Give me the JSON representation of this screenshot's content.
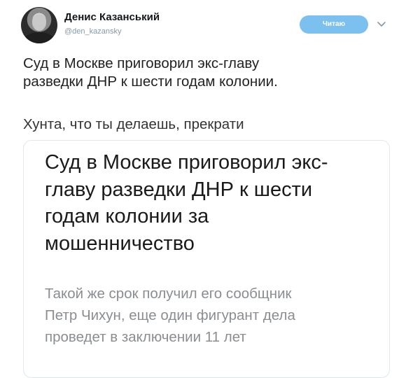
{
  "author": {
    "name": "Денис Казанський",
    "handle": "@den_kazansky"
  },
  "header": {
    "follow_label": "Читаю"
  },
  "tweet": {
    "lines": [
      "Суд в Москве приговорил экс-главу",
      "разведки ДНР к шести годам колонии."
    ],
    "comment": "Хунта, что ты делаешь, прекрати"
  },
  "card": {
    "title_lines": [
      "Суд в Москве приговорил экс-",
      "главу разведки ДНР к шести",
      "годам колонии за",
      "мошенничество"
    ],
    "description_lines": [
      "Такой же срок получил его сообщник",
      "Петр Чихун, еще один фигурант дела",
      "проведет в заключении 11 лет"
    ]
  },
  "colors": {
    "follow_button": "#7cc0ef",
    "handle": "#8899a6",
    "card_border": "#e1e8ed",
    "card_description": "#8a8d91"
  },
  "icons": {
    "more_menu": "chevron-down-icon",
    "avatar": "profile-photo"
  }
}
